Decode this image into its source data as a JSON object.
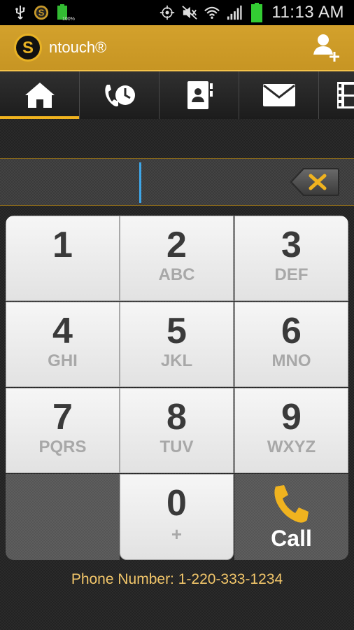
{
  "status_bar": {
    "time": "11:13 AM",
    "battery_label": "100%",
    "icons": [
      "usb-icon",
      "ntouch-notification-icon",
      "battery-icon",
      "gps-icon",
      "mute-icon",
      "wifi-icon",
      "signal-icon",
      "battery-full-icon"
    ]
  },
  "app_bar": {
    "title": "ntouch®",
    "logo_letter": "S",
    "add_contact_icon": "add-contact-icon"
  },
  "tabs": [
    {
      "name": "home",
      "icon": "home-icon",
      "active": true
    },
    {
      "name": "history",
      "icon": "call-history-icon",
      "active": false
    },
    {
      "name": "contacts",
      "icon": "contacts-icon",
      "active": false
    },
    {
      "name": "messages",
      "icon": "mail-icon",
      "active": false
    },
    {
      "name": "videos",
      "icon": "film-icon",
      "active": false
    }
  ],
  "dial_input": {
    "value": ""
  },
  "keypad": {
    "keys": [
      {
        "digit": "1",
        "letters": ""
      },
      {
        "digit": "2",
        "letters": "ABC"
      },
      {
        "digit": "3",
        "letters": "DEF"
      },
      {
        "digit": "4",
        "letters": "GHI"
      },
      {
        "digit": "5",
        "letters": "JKL"
      },
      {
        "digit": "6",
        "letters": "MNO"
      },
      {
        "digit": "7",
        "letters": "PQRS"
      },
      {
        "digit": "8",
        "letters": "TUV"
      },
      {
        "digit": "9",
        "letters": "WXYZ"
      },
      {
        "digit": "0",
        "letters": "+"
      }
    ],
    "call_label": "Call"
  },
  "footer": {
    "phone_number_text": "Phone Number: 1-220-333-1234"
  },
  "colors": {
    "accent": "#d3a12c",
    "call_icon": "#f0b31f",
    "cursor": "#3ea6e8",
    "phone_number_text": "#f2c66a"
  }
}
